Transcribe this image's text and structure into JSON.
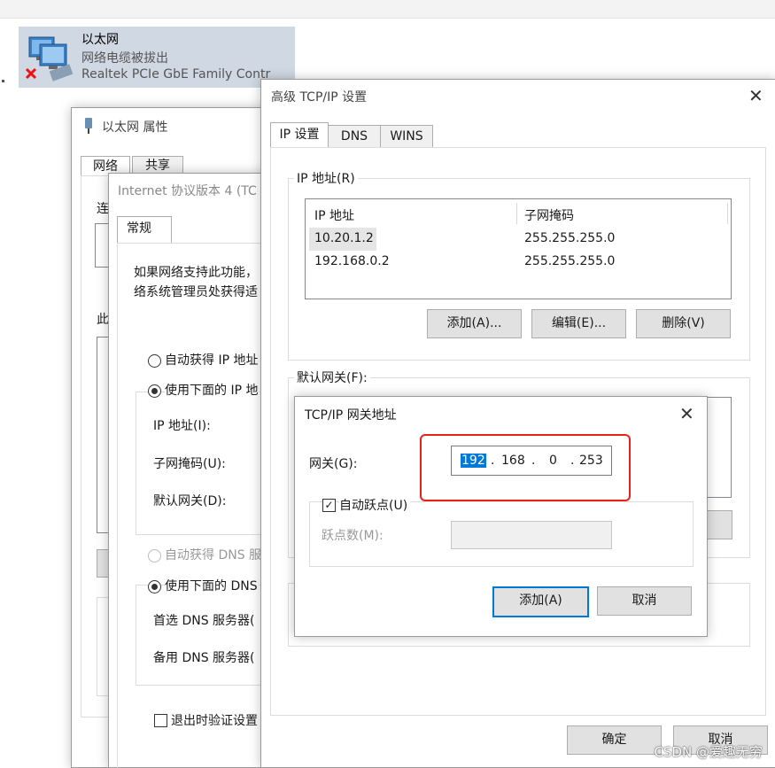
{
  "adapter": {
    "name": "以太网",
    "status": "网络电缆被拔出",
    "device": "Realtek PCIe GbE Family Contr"
  },
  "props_window": {
    "title": "以太网 属性",
    "tabs": [
      "网络",
      "共享"
    ],
    "partial_connect": "连",
    "partial_this": "此"
  },
  "ipv4_window": {
    "title": "Internet 协议版本 4 (TC",
    "tab": "常规",
    "desc_line1": "如果网络支持此功能，",
    "desc_line2": "络系统管理员处获得适",
    "auto_ip": "自动获得 IP 地址",
    "use_ip": "使用下面的 IP 地",
    "ip_label": "IP 地址(I):",
    "mask_label": "子网掩码(U):",
    "gw_label": "默认网关(D):",
    "auto_dns": "自动获得 DNS 服",
    "use_dns": "使用下面的 DNS",
    "pref_dns": "首选 DNS 服务器(",
    "alt_dns": "备用 DNS 服务器(",
    "validate": "退出时验证设置"
  },
  "adv_window": {
    "title": "高级 TCP/IP 设置",
    "tabs": [
      "IP 设置",
      "DNS",
      "WINS"
    ],
    "ip_group": "IP 地址(R)",
    "col_ip": "IP 地址",
    "col_mask": "子网掩码",
    "rows": [
      {
        "ip": "10.20.1.2",
        "mask": "255.255.255.0"
      },
      {
        "ip": "192.168.0.2",
        "mask": "255.255.255.0"
      }
    ],
    "add": "添加(A)...",
    "edit": "编辑(E)...",
    "delete": "删除(V)",
    "gw_group": "默认网关(F):",
    "ok": "确定",
    "cancel": "取消"
  },
  "gw_dialog": {
    "title": "TCP/IP 网关地址",
    "gw_label": "网关(G):",
    "octets": [
      "192",
      "168",
      "0",
      "253"
    ],
    "auto_metric": "自动跃点(U)",
    "metric_label": "跃点数(M):",
    "add": "添加(A)",
    "cancel": "取消"
  },
  "watermark": "CSDN @爱趣无穷",
  "colors": {
    "accent": "#0078d7",
    "highlight_box": "#e8221a"
  }
}
